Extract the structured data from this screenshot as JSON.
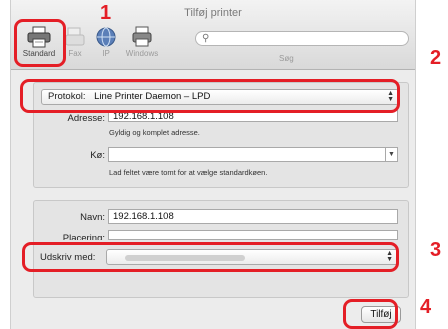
{
  "window": {
    "title": "Tilføj printer"
  },
  "toolbar": {
    "buttons": [
      {
        "label": "Standard",
        "icon": "printer-icon"
      },
      {
        "label": "Fax",
        "icon": "fax-icon"
      },
      {
        "label": "IP",
        "icon": "globe-icon"
      },
      {
        "label": "Windows",
        "icon": "windows-printer-icon"
      }
    ],
    "search_label": "Søg",
    "search_value": ""
  },
  "form": {
    "protocol_label": "Protokol:",
    "protocol_value": "Line Printer Daemon – LPD",
    "address_label": "Adresse:",
    "address_value": "192.168.1.108",
    "address_hint": "Gyldig og komplet adresse.",
    "queue_label": "Kø:",
    "queue_value": "",
    "queue_hint": "Lad feltet være tomt for at vælge standardkøen.",
    "name_label": "Navn:",
    "name_value": "192.168.1.108",
    "location_label": "Placering:",
    "location_value": "",
    "print_with_label": "Udskriv med:",
    "add_button": "Tilføj"
  },
  "annotations": {
    "steps": [
      "1",
      "2",
      "3",
      "4"
    ],
    "highlight_color": "#e41e26"
  }
}
